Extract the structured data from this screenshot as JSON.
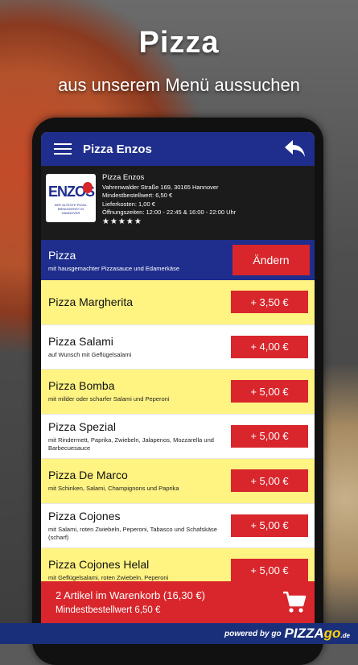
{
  "headline": {
    "title": "Pizza",
    "subtitle": "aus unserem Menü aussuchen"
  },
  "appbar": {
    "title": "Pizza Enzos"
  },
  "restaurant": {
    "logo_text": "ENZOS",
    "logo_subtext": "DER ÄLTESTE PIZZA-BRINGDIENST IN HANNOVER",
    "name": "Pizza Enzos",
    "address": "Vahrenwalder Straße 169, 30165 Hannover",
    "min_order": "Mindestbestellwert: 6,50 €",
    "delivery": "Lieferkosten: 1,00 €",
    "hours": "Öffnungszeiten: 12:00 - 22:45 & 16:00 - 22:00 Uhr",
    "stars": "★★★★★",
    "rating": 5
  },
  "category": {
    "name": "Pizza",
    "description": "mit hausgemachter Pizzasauce und Edamerkäse",
    "button_label": "Ändern"
  },
  "items": [
    {
      "name": "Pizza Margherita",
      "description": "",
      "price": "+ 3,50 €"
    },
    {
      "name": "Pizza Salami",
      "description": "auf Wunsch mit Geflügelsalami",
      "price": "+ 4,00 €"
    },
    {
      "name": "Pizza Bomba",
      "description": "mit milder oder scharfer Salami und Peperoni",
      "price": "+ 5,00 €"
    },
    {
      "name": "Pizza Spezial",
      "description": "mit Rindermett, Paprika, Zwiebeln, Jalapenos, Mozzarella und Barbecuesauce",
      "price": "+ 5,00 €"
    },
    {
      "name": "Pizza De Marco",
      "description": "mit Schinken, Salami, Champignons und Paprika",
      "price": "+ 5,00 €"
    },
    {
      "name": "Pizza Cojones",
      "description": "mit Salami, roten Zwiebeln, Peperoni, Tabasco und Schafskäse (scharf)",
      "price": "+ 5,00 €"
    },
    {
      "name": "Pizza Cojones Helal",
      "description": "mit Geflügelsalami, roten Zwiebeln, Peperoni",
      "price": "+ 5,00 €"
    }
  ],
  "cart": {
    "line1": "2 Artikel im Warenkorb (16,30 €)",
    "line2": "Mindestbestellwert 6,50 €"
  },
  "footer": {
    "powered": "powered by go",
    "brand_main": "PIZZA",
    "brand_go": "go",
    "brand_tld": ".de"
  },
  "colors": {
    "primary_blue": "#1f2e8c",
    "accent_red": "#d8262c",
    "row_yellow": "#fff382"
  }
}
